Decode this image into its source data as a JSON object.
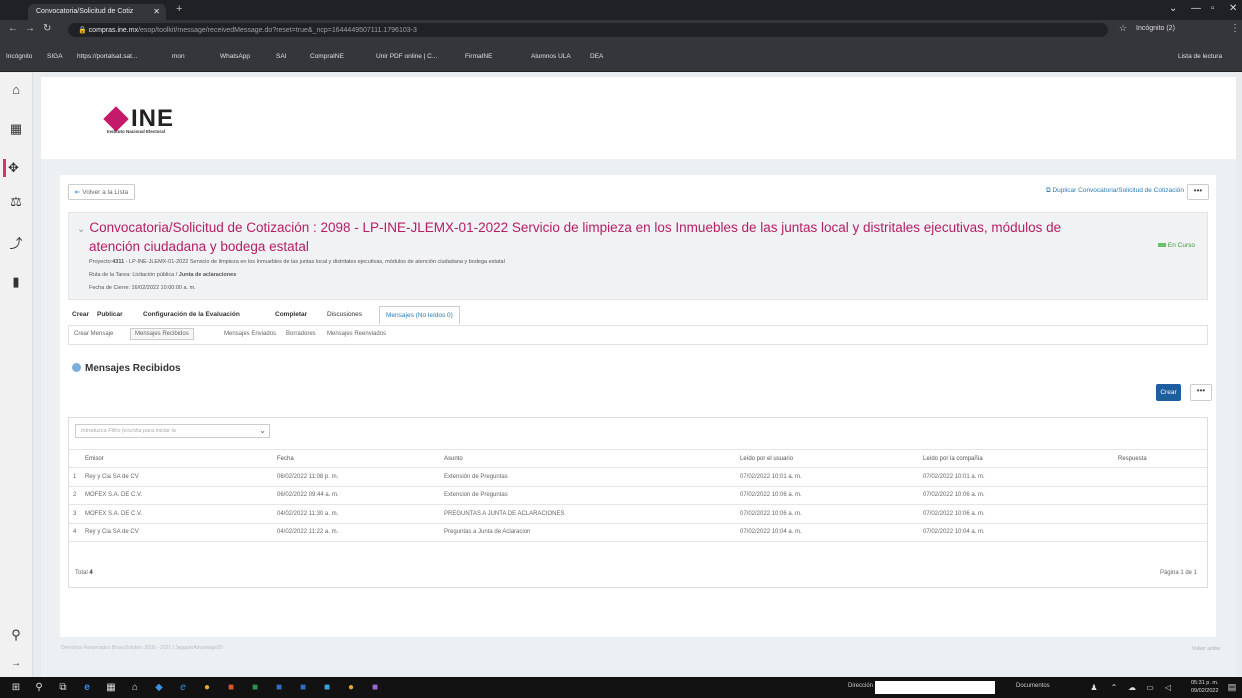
{
  "browser": {
    "tab_title": "Convocatoria/Solicitud de Cotiz",
    "url_host": "compras.ine.mx",
    "url_path": "/esop/toolkit/message/receivedMessage.do?reset=true&_ncp=1644449507111.1796103-3",
    "profile": "Incógnito (2)",
    "reading_list": "Lista de lectura",
    "bookmarks": [
      "Incógnito",
      "SIGA",
      "https://portalsat.sat...",
      "mon",
      "WhatsApp",
      "SAI",
      "CompraINE",
      "Unir PDF online | C...",
      "FirmaINE",
      "Alumnos ULA",
      "DEA"
    ]
  },
  "header": {
    "logo_text": "INE",
    "logo_sub": "Instituto Nacional Electoral"
  },
  "toolbar": {
    "back_label": "Volver a la Lista",
    "duplicate_label": "Duplicar Convocatoria/Solicitud de Cotización",
    "more": "•••"
  },
  "summary": {
    "title": "Convocatoria/Solicitud de Cotización : 2098 - LP-INE-JLEMX-01-2022 Servicio de limpieza en los Inmuebles de las juntas local y distritales ejecutivas, módulos de atención ciudadana y bodega estatal",
    "proyecto_label": "Proyecto:",
    "proyecto_value": "4311",
    "proyecto_rest": " - LP-INE-JLEMX-01-2022 Servicio de limpieza en los Inmuebles de las juntas local y distritales ejecutivas, módulos de atención ciudadana y bodega estatal",
    "ruta_label": "Ruta de la Tarea: Licitación pública / ",
    "ruta_value": "Junta de aclaraciones",
    "fecha": "Fecha de Cierre: 16/02/2022 10:00:00 a. m.",
    "status": "En Curso"
  },
  "tabs": [
    "Crear",
    "Publicar",
    "Configuración de la Evaluación",
    "Completar",
    "Discusiones",
    "Mensajes (No leídos 0)"
  ],
  "subtabs": [
    "Crear Mensaje",
    "Mensajes Recibidos",
    "Mensajes Enviados",
    "Borradores",
    "Mensajes Reenviados"
  ],
  "section_title": "Mensajes Recibidos",
  "create_button": "Crear",
  "filter_placeholder": "Introduzca Filtro (escriba para iniciar la",
  "columns": [
    "Emisor",
    "Fecha",
    "Asunto",
    "Leído por el usuario",
    "Leído por la compañía",
    "Respuesta"
  ],
  "rows": [
    {
      "n": "1",
      "emisor": "Rey y Cia SA de CV",
      "fecha": "06/02/2022 11:08 p. m.",
      "asunto": "Extensión de Preguntas",
      "leido_usuario": "07/02/2022 10:01 a. m.",
      "leido_compania": "07/02/2022 10:01 a. m."
    },
    {
      "n": "2",
      "emisor": "MOFEX S.A. DE C.V.",
      "fecha": "06/02/2022 09:44 a. m.",
      "asunto": "Extencion de Preguntas",
      "leido_usuario": "07/02/2022 10:06 a. m.",
      "leido_compania": "07/02/2022 10:06 a. m."
    },
    {
      "n": "3",
      "emisor": "MOFEX S.A. DE C.V.",
      "fecha": "04/02/2022 11:30 a. m.",
      "asunto": "PREGUNTAS A JUNTA DE ACLARACIONES",
      "leido_usuario": "07/02/2022 10:06 a. m.",
      "leido_compania": "07/02/2022 10:06 a. m."
    },
    {
      "n": "4",
      "emisor": "Rey y Cia SA de CV",
      "fecha": "04/02/2022 11:22 a. m.",
      "asunto": "Preguntas a Junta de Aclaracion",
      "leido_usuario": "07/02/2022 10:04 a. m.",
      "leido_compania": "07/02/2022 10:04 a. m."
    }
  ],
  "total_label": "Total ",
  "total_value": "4",
  "pagination": "Página 1 de 1",
  "footer": "Derechos Reservados BravoSolution 2000 - 2021 | JaggaerAdvantage20",
  "back_to_top": "Volver arriba",
  "taskbar": {
    "address_label": "Dirección",
    "documents_label": "Documentos",
    "time": "05:31 p. m.",
    "date": "09/02/2022"
  },
  "colors": {
    "brand": "#c51a6c",
    "accent": "#1d5ea0",
    "status": "#3a9b3a"
  }
}
